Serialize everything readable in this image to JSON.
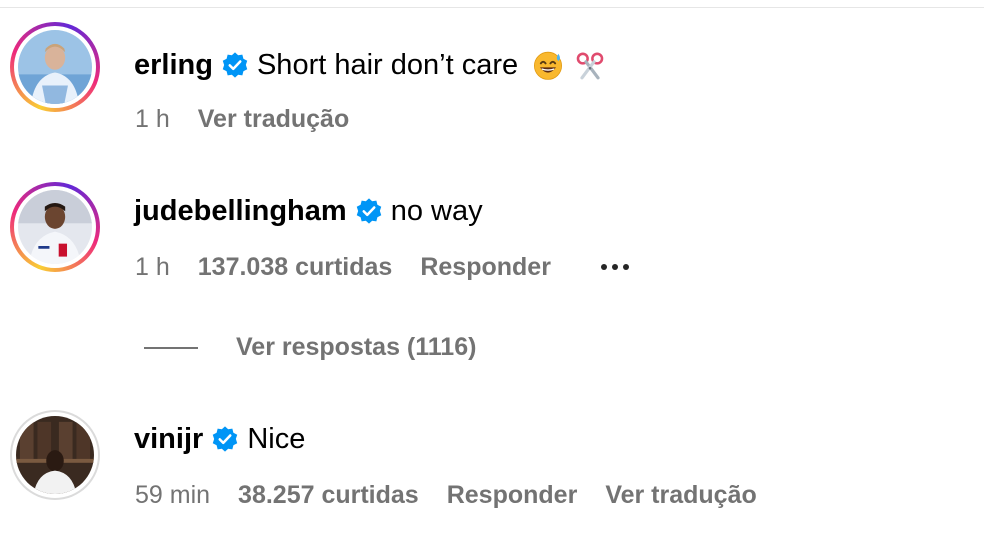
{
  "comments": [
    {
      "username": "erling",
      "text": "Short hair don’t care",
      "emojis": [
        "grinning-sweat-emoji",
        "scissors-emoji"
      ],
      "time": "1 h",
      "translate_label": "Ver tradução",
      "avatar": "avatar-erling",
      "ring": "story"
    },
    {
      "username": "judebellingham",
      "text": "no way",
      "time": "1 h",
      "likes": "137.038 curtidas",
      "reply_label": "Responder",
      "avatar": "avatar-judebellingham",
      "ring": "story",
      "replies_label": "Ver respostas (1116)"
    },
    {
      "username": "vinijr",
      "text": "Nice",
      "time": "59 min",
      "likes": "38.257 curtidas",
      "reply_label": "Responder",
      "translate_label": "Ver tradução",
      "avatar": "avatar-vinijr",
      "ring": "seen"
    }
  ],
  "colors": {
    "verified_blue": "#0095f6",
    "meta_gray": "#737373",
    "text": "#000000",
    "divider": "#e6e6e6"
  }
}
